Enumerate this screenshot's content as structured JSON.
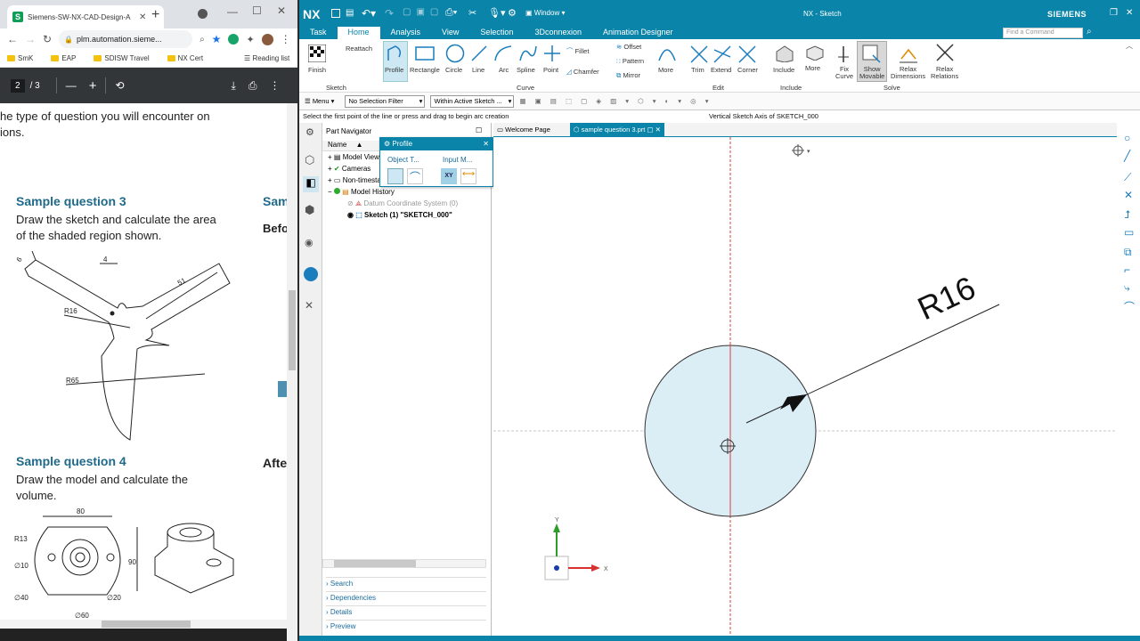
{
  "browser": {
    "tab_title": "Siemens-SW-NX-CAD-Design-A",
    "url": "plm.automation.sieme...",
    "bookmarks": [
      "SmK",
      "EAP",
      "SDISW Travel",
      "NX Cert"
    ],
    "reading_list": "Reading list",
    "pdf_page": "2",
    "pdf_total": "/ 3",
    "intro_line1": "he type of question you will encounter on",
    "intro_line2": "ions.",
    "q3_title": "Sample question 3",
    "q3_text1": "Draw the sketch and calculate the area",
    "q3_text2": "of the shaded region shown.",
    "q3_side": "Samp",
    "q3_side2": "Befo",
    "q3_dims": {
      "d6": "6",
      "d4": "4",
      "d51": "51",
      "r16": "R16",
      "r65": "R65"
    },
    "q4_title": "Sample question 4",
    "q4_text1": "Draw the model and calculate the",
    "q4_text2": "volume.",
    "q4_side": "Afte",
    "q4_dims": {
      "d80": "80",
      "r13": "R13",
      "d10": "∅10",
      "d90": "90",
      "d40": "∅40",
      "d20": "∅20",
      "d60": "∅60"
    }
  },
  "nx": {
    "logo": "NX",
    "window_menu": "Window",
    "title": "NX - Sketch",
    "brand": "SIEMENS",
    "find_placeholder": "Find a Command",
    "tabs": [
      "Task",
      "Home",
      "Analysis",
      "View",
      "Selection",
      "3Dconnexion",
      "Animation Designer"
    ],
    "active_tab": "Home",
    "ribbon": {
      "finish": "Finish",
      "reattach": "Reattach",
      "profile": "Profile",
      "rectangle": "Rectangle",
      "circle": "Circle",
      "line": "Line",
      "arc": "Arc",
      "spline": "Spline",
      "point": "Point",
      "fillet": "Fillet",
      "chamfer": "Chamfer",
      "offset": "Offset",
      "pattern": "Pattern",
      "mirror": "Mirror",
      "more1": "More",
      "trim": "Trim",
      "extend": "Extend",
      "corner": "Corner",
      "include": "Include",
      "more2": "More",
      "fix_curve": [
        "Fix",
        "Curve"
      ],
      "show_movable": [
        "Show",
        "Movable"
      ],
      "relax_dims": [
        "Relax",
        "Dimensions"
      ],
      "relax_rel": [
        "Relax",
        "Relations"
      ],
      "groups": [
        "Sketch",
        "Curve",
        "Edit",
        "Include",
        "Solve"
      ]
    },
    "menu": "Menu",
    "selection_filter": "No Selection Filter",
    "scope": "Within Active Sketch ...",
    "status_left": "Select the first point of the line or press and drag to begin arc creation",
    "status_right": "Vertical Sketch Axis of SKETCH_000",
    "part_nav": {
      "title": "Part Navigator",
      "col_name": "Name",
      "items": [
        "Model Views",
        "Cameras",
        "Non-timestamp",
        "Model History",
        "Datum Coordinate System (0)",
        "Sketch (1) \"SKETCH_000\""
      ]
    },
    "profile_popup": {
      "title": "Profile",
      "object_type": "Object T...",
      "input_mode": "Input M...",
      "xy": "XY"
    },
    "panels": [
      "Search",
      "Dependencies",
      "Details",
      "Preview"
    ],
    "doc_tabs": [
      "Welcome Page",
      "sample question 3.prt"
    ],
    "dimension": "R16",
    "axis_x": "X",
    "axis_y": "Y",
    "accent": "#0a84a8",
    "circle_fill": "#dbeef5"
  }
}
